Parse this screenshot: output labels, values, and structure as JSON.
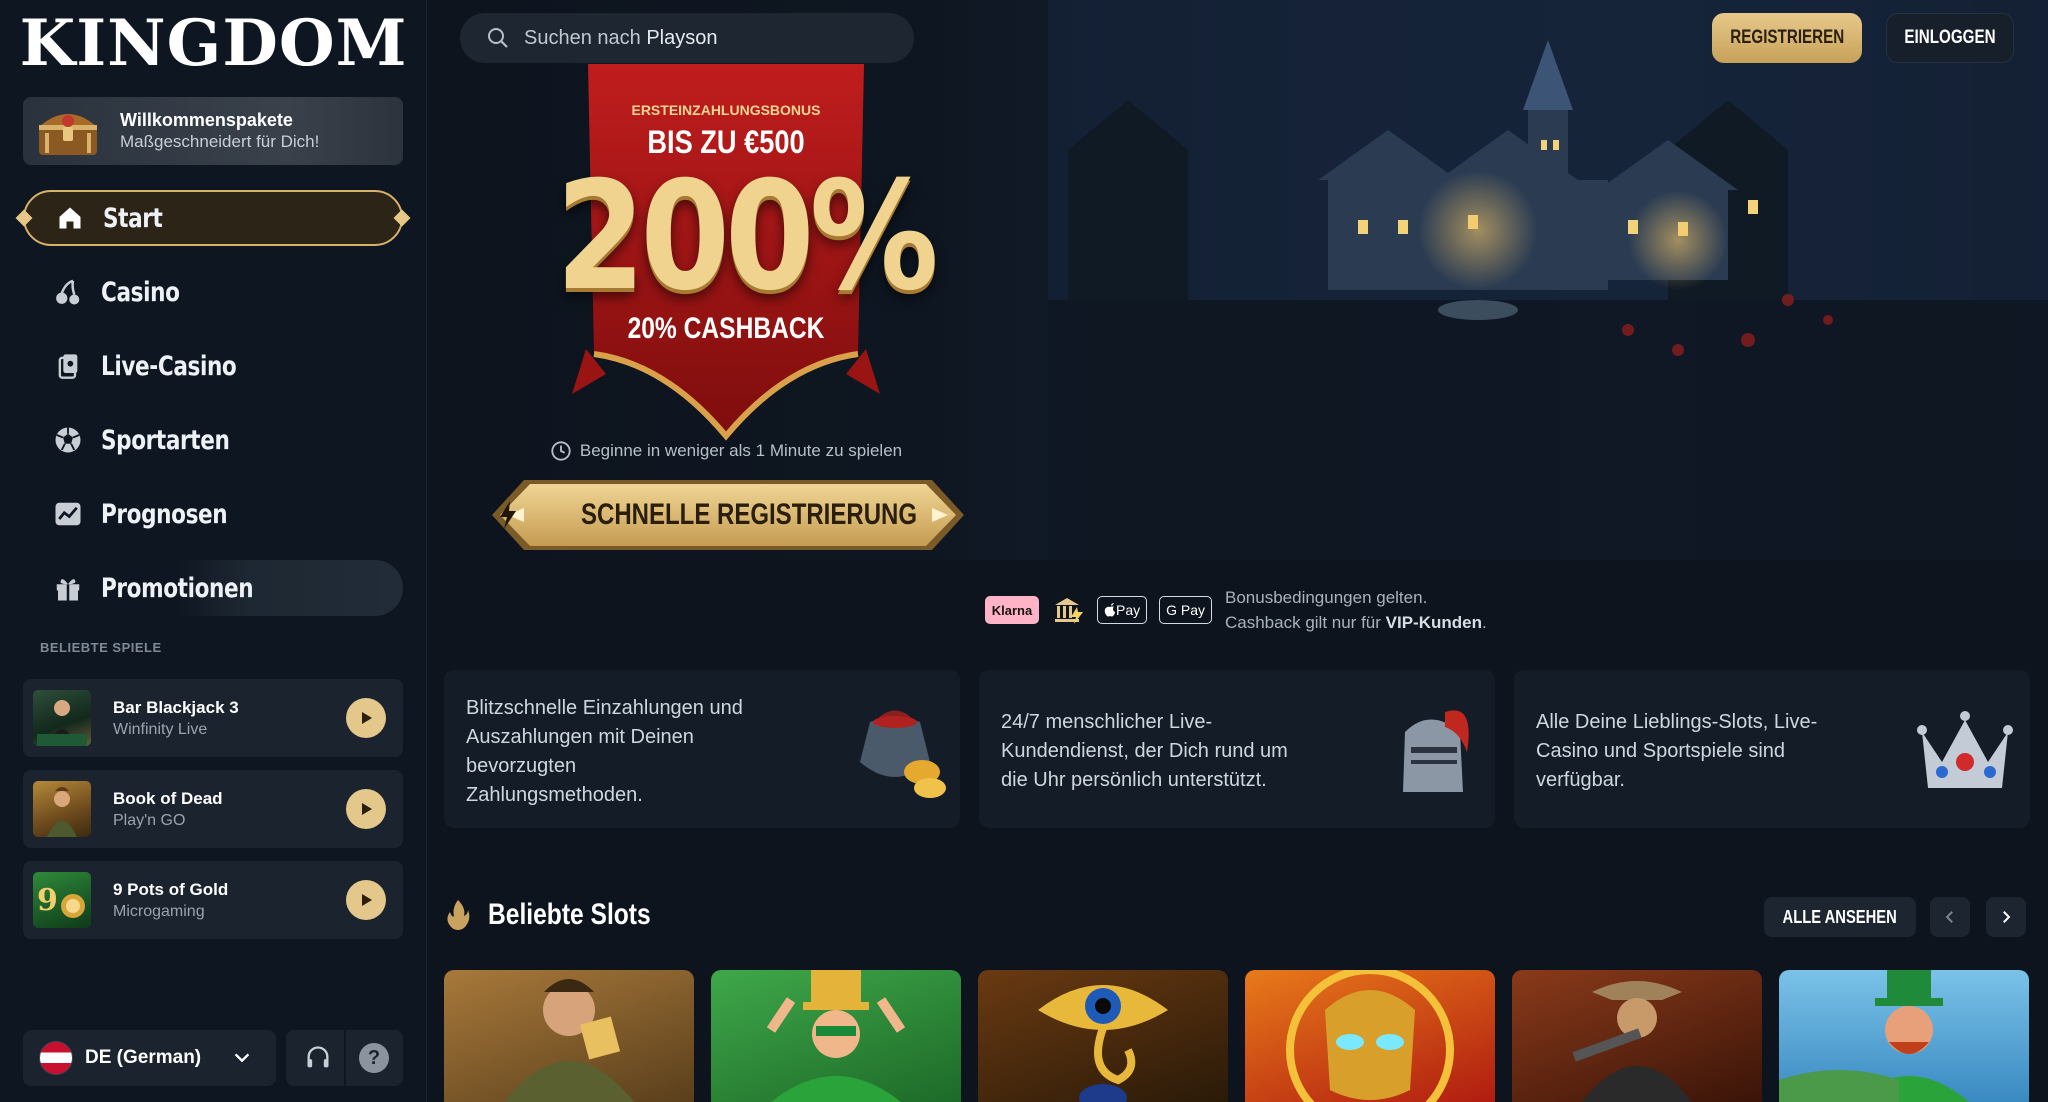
{
  "brand": {
    "logo_text": "KINGDOM"
  },
  "sidebar": {
    "welcome": {
      "title": "Willkommenspakete",
      "subtitle": "Maßgeschneidert für Dich!"
    },
    "nav": [
      {
        "label": "Start",
        "icon": "home-icon",
        "active": true
      },
      {
        "label": "Casino",
        "icon": "cherries-icon"
      },
      {
        "label": "Live-Casino",
        "icon": "cards-icon"
      },
      {
        "label": "Sportarten",
        "icon": "soccer-ball-icon"
      },
      {
        "label": "Prognosen",
        "icon": "chart-icon"
      },
      {
        "label": "Promotionen",
        "icon": "gift-icon"
      }
    ],
    "popular_label": "BELIEBTE SPIELE",
    "popular_games": [
      {
        "title": "Bar Blackjack 3",
        "provider": "Winfinity Live"
      },
      {
        "title": "Book of Dead",
        "provider": "Play'n GO"
      },
      {
        "title": "9 Pots of Gold",
        "provider": "Microgaming"
      }
    ],
    "language": {
      "label": "DE (German)"
    }
  },
  "header": {
    "search_placeholder": "Suchen nach",
    "search_value": "Playson",
    "register_label": "REGISTRIEREN",
    "login_label": "EINLOGGEN"
  },
  "hero": {
    "bonus_top": "ERSTEINZAHLUNGSBONUS",
    "bonus_amount": "BIS ZU €500",
    "bonus_percent": "200%",
    "bonus_cashback": "20% CASHBACK",
    "begin_text": "Beginne in weniger als 1 Minute zu spielen",
    "quick_register_label": "SCHNELLE REGISTRIERUNG"
  },
  "payments": {
    "methods": [
      "Klarna",
      "Pay",
      "G Pay"
    ],
    "terms_line1": "Bonusbedingungen gelten.",
    "terms_line2_prefix": "Cashback gilt nur für ",
    "terms_line2_bold": "VIP-Kunden",
    "terms_line2_suffix": "."
  },
  "features": [
    {
      "lines": [
        "Blitzschnelle Einzahlungen und",
        "Auszahlungen mit Deinen",
        "bevorzugten",
        "Zahlungsmethoden."
      ]
    },
    {
      "lines": [
        "24/7 menschlicher Live-",
        "Kundendienst, der Dich rund um",
        "die Uhr persönlich unterstützt."
      ]
    },
    {
      "lines": [
        "Alle Deine Lieblings-Slots, Live-",
        "Casino und Sportspiele sind",
        "verfügbar."
      ]
    }
  ],
  "slots": {
    "title": "Beliebte Slots",
    "view_all_label": "ALLE ANSEHEN"
  },
  "colors": {
    "gold": "#d9b36b",
    "background": "#0d141e",
    "card": "#1a232e",
    "accent_red": "#b11a1a"
  }
}
